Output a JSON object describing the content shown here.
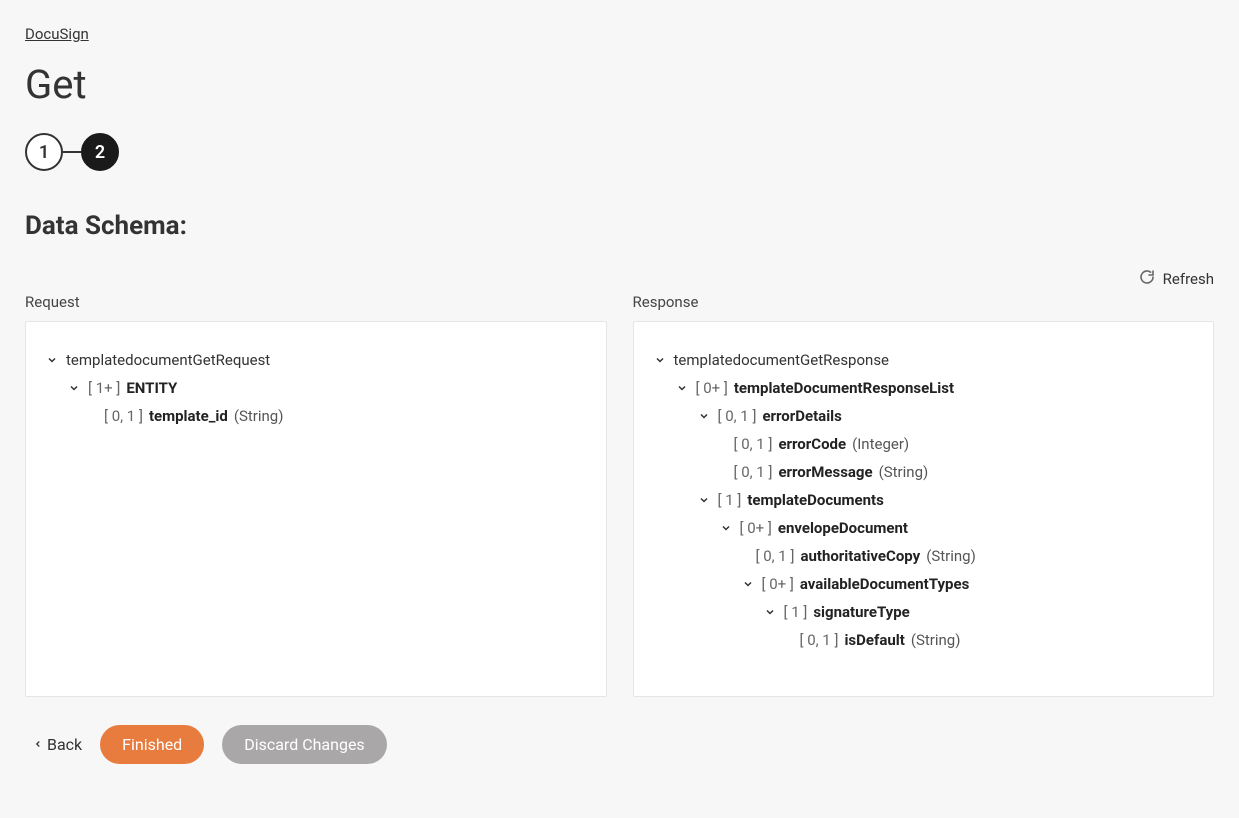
{
  "breadcrumb": "DocuSign",
  "page_title": "Get",
  "steps": {
    "one": "1",
    "two": "2"
  },
  "section_title": "Data Schema:",
  "refresh_label": "Refresh",
  "panel_labels": {
    "request": "Request",
    "response": "Response"
  },
  "request_tree": {
    "root": {
      "label": "templatedocumentGetRequest"
    },
    "entity": {
      "card": "[ 1+ ]",
      "name": "ENTITY"
    },
    "template_id": {
      "card": "[ 0, 1 ]",
      "name": "template_id",
      "type": "(String)"
    }
  },
  "response_tree": {
    "root": {
      "label": "templatedocumentGetResponse"
    },
    "list": {
      "card": "[ 0+ ]",
      "name": "templateDocumentResponseList"
    },
    "errorDetails": {
      "card": "[ 0, 1 ]",
      "name": "errorDetails"
    },
    "errorCode": {
      "card": "[ 0, 1 ]",
      "name": "errorCode",
      "type": "(Integer)"
    },
    "errorMessage": {
      "card": "[ 0, 1 ]",
      "name": "errorMessage",
      "type": "(String)"
    },
    "templateDocuments": {
      "card": "[ 1 ]",
      "name": "templateDocuments"
    },
    "envelopeDocument": {
      "card": "[ 0+ ]",
      "name": "envelopeDocument"
    },
    "authoritativeCopy": {
      "card": "[ 0, 1 ]",
      "name": "authoritativeCopy",
      "type": "(String)"
    },
    "availableDocumentTypes": {
      "card": "[ 0+ ]",
      "name": "availableDocumentTypes"
    },
    "signatureType": {
      "card": "[ 1 ]",
      "name": "signatureType"
    },
    "isDefault": {
      "card": "[ 0, 1 ]",
      "name": "isDefault",
      "type": "(String)"
    }
  },
  "footer": {
    "back": "Back",
    "finished": "Finished",
    "discard": "Discard Changes"
  }
}
